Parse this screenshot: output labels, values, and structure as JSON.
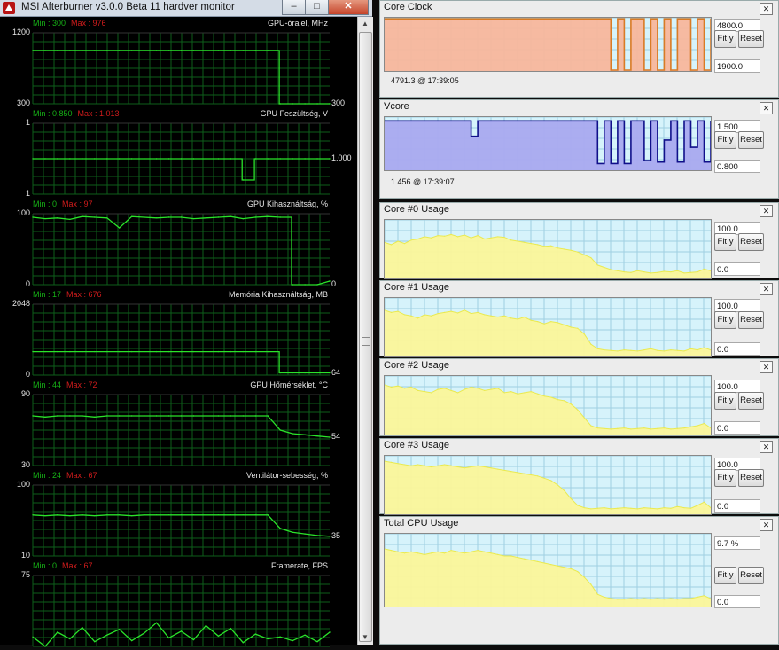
{
  "afterburner": {
    "title": "MSI Afterburner v3.0.0 Beta 11 hardver monitor",
    "graphs": [
      {
        "id": "gpu-clock",
        "name": "GPU-órajel, MHz",
        "min": "Min : 300",
        "max": "Max : 976",
        "top": "1200",
        "bottom": "300",
        "right": "300",
        "right_value": 300,
        "range": [
          300,
          1200
        ],
        "right2": ""
      },
      {
        "id": "gpu-voltage",
        "name": "GPU Feszültség, V",
        "min": "Min : 0.850",
        "max": "Max : 1.013",
        "top": "1",
        "bottom": "1",
        "right": "1.000",
        "right_value": 1.0,
        "range": [
          0.75,
          1.25
        ],
        "right2": ""
      },
      {
        "id": "gpu-usage",
        "name": "GPU Kihasználtság, %",
        "min": "Min : 0",
        "max": "Max : 97",
        "top": "100",
        "bottom": "0",
        "right": "0",
        "right_value": 0,
        "range": [
          0,
          100
        ],
        "right2": ""
      },
      {
        "id": "mem-usage",
        "name": "Memória Kihasználtság, MB",
        "min": "Min : 17",
        "max": "Max : 676",
        "top": "2048",
        "bottom": "0",
        "right": "64",
        "right_value": 64,
        "range": [
          0,
          2048
        ],
        "right2": ""
      },
      {
        "id": "gpu-temp",
        "name": "GPU Hőmérséklet, °C",
        "min": "Min : 44",
        "max": "Max : 72",
        "top": "90",
        "bottom": "30",
        "right": "54",
        "right_value": 54,
        "range": [
          30,
          90
        ],
        "right2": ""
      },
      {
        "id": "fan-speed",
        "name": "Ventilátor-sebesség, %",
        "min": "Min : 24",
        "max": "Max : 67",
        "top": "100",
        "bottom": "10",
        "right": "35",
        "right_value": 35,
        "range": [
          10,
          100
        ],
        "right2": ""
      },
      {
        "id": "framerate",
        "name": "Framerate, FPS",
        "min": "Min : 0",
        "max": "Max : 67",
        "top": "75",
        "bottom": "",
        "right": "",
        "right_value": null,
        "range": [
          0,
          75
        ],
        "right2": ""
      }
    ],
    "colors": {
      "line": "#2ae32a",
      "grid": "#0e5e1a",
      "bg": "#000000",
      "min": "#16b016",
      "max": "#d11c1c"
    }
  },
  "panels": [
    {
      "id": "core-clock",
      "title": "Core Clock",
      "top_value": "4800.0",
      "bottom_value": "1900.0",
      "info": "4791.3  @ 17:39:05",
      "fill": "#f8b69c",
      "line": "#d97b25",
      "min": 1900,
      "max": 4800,
      "kind": "clock",
      "fit": "Fit y",
      "reset": "Reset"
    },
    {
      "id": "vcore",
      "title": "Vcore",
      "top_value": "1.500",
      "bottom_value": "0.800",
      "info": "1.456  @ 17:39:07",
      "fill": "#a9a9ef",
      "line": "#10108a",
      "min": 0.8,
      "max": 1.5,
      "kind": "vcore",
      "fit": "Fit y",
      "reset": "Reset"
    },
    {
      "id": "core0",
      "title": "Core #0 Usage",
      "top_value": "100.0",
      "bottom_value": "0.0",
      "info": "",
      "fill": "#fbf69a",
      "line": "#eaea50",
      "min": 0,
      "max": 100,
      "kind": "usage",
      "fit": "Fit y",
      "reset": "Reset"
    },
    {
      "id": "core1",
      "title": "Core #1 Usage",
      "top_value": "100.0",
      "bottom_value": "0.0",
      "info": "",
      "fill": "#fbf69a",
      "line": "#eaea50",
      "min": 0,
      "max": 100,
      "kind": "usage",
      "fit": "Fit y",
      "reset": "Reset"
    },
    {
      "id": "core2",
      "title": "Core #2 Usage",
      "top_value": "100.0",
      "bottom_value": "0.0",
      "info": "",
      "fill": "#fbf69a",
      "line": "#eaea50",
      "min": 0,
      "max": 100,
      "kind": "usage",
      "fit": "Fit y",
      "reset": "Reset"
    },
    {
      "id": "core3",
      "title": "Core #3 Usage",
      "top_value": "100.0",
      "bottom_value": "0.0",
      "info": "",
      "fill": "#fbf69a",
      "line": "#eaea50",
      "min": 0,
      "max": 100,
      "kind": "usage",
      "fit": "Fit y",
      "reset": "Reset"
    },
    {
      "id": "total",
      "title": "Total CPU Usage",
      "top_value": "9.7 %",
      "bottom_value": "0.0",
      "info": "",
      "fill": "#fbf69a",
      "line": "#eaea50",
      "min": 0,
      "max": 100,
      "kind": "total",
      "fit": "Fit y",
      "reset": "Reset"
    }
  ],
  "chart_data": [
    {
      "type": "line",
      "title": "GPU-órajel, MHz",
      "ylim": [
        300,
        1200
      ],
      "series": [
        {
          "values": [
            976,
            976,
            976,
            976,
            976,
            976,
            976,
            976,
            976,
            976,
            976,
            976,
            976,
            976,
            976,
            976,
            976,
            976,
            976,
            976,
            300,
            300,
            300,
            300,
            300
          ]
        }
      ]
    },
    {
      "type": "line",
      "title": "GPU Feszültség, V",
      "ylim": [
        0.75,
        1.25
      ],
      "series": [
        {
          "values": [
            1.0,
            1.0,
            1.0,
            1.0,
            1.0,
            1.0,
            1.0,
            1.0,
            1.0,
            1.0,
            1.0,
            1.0,
            1.0,
            1.0,
            1.0,
            1.0,
            1.0,
            0.85,
            1.0,
            1.0,
            1.0,
            1.0,
            1.0,
            1.0,
            1.0
          ]
        }
      ]
    },
    {
      "type": "line",
      "title": "GPU Kihasználtság, %",
      "ylim": [
        0,
        100
      ],
      "series": [
        {
          "values": [
            95,
            93,
            94,
            92,
            96,
            95,
            94,
            80,
            96,
            95,
            94,
            95,
            95,
            93,
            94,
            95,
            96,
            93,
            95,
            96,
            95,
            0,
            0,
            0,
            5
          ]
        }
      ]
    },
    {
      "type": "line",
      "title": "Memória Kihasználtság, MB",
      "ylim": [
        0,
        2048
      ],
      "series": [
        {
          "values": [
            676,
            676,
            676,
            676,
            676,
            676,
            676,
            676,
            676,
            676,
            676,
            676,
            676,
            676,
            676,
            676,
            676,
            676,
            676,
            676,
            64,
            64,
            64,
            64,
            64
          ]
        }
      ]
    },
    {
      "type": "line",
      "title": "GPU Hőmérséklet, °C",
      "ylim": [
        30,
        90
      ],
      "series": [
        {
          "values": [
            72,
            71,
            72,
            72,
            72,
            71,
            72,
            72,
            72,
            72,
            72,
            72,
            72,
            72,
            72,
            72,
            72,
            72,
            72,
            72,
            60,
            57,
            56,
            55,
            54
          ]
        }
      ]
    },
    {
      "type": "line",
      "title": "Ventilátor-sebesség, %",
      "ylim": [
        10,
        100
      ],
      "series": [
        {
          "values": [
            62,
            61,
            62,
            61,
            62,
            61,
            62,
            62,
            61,
            62,
            62,
            62,
            62,
            62,
            62,
            62,
            62,
            62,
            62,
            62,
            45,
            40,
            38,
            36,
            35
          ]
        }
      ]
    },
    {
      "type": "line",
      "title": "Framerate, FPS",
      "ylim": [
        0,
        75
      ],
      "series": [
        {
          "values": [
            10,
            0,
            15,
            8,
            20,
            5,
            12,
            18,
            6,
            14,
            25,
            9,
            16,
            7,
            22,
            11,
            19,
            4,
            13,
            8,
            10,
            6,
            12,
            5,
            15
          ]
        }
      ]
    },
    {
      "type": "area",
      "title": "Core Clock",
      "ylim": [
        1900,
        4800
      ],
      "series": [
        {
          "values": [
            4791,
            4791,
            4791,
            4791,
            4791,
            4791,
            4791,
            4791,
            4791,
            4791,
            4791,
            4791,
            4791,
            4791,
            4791,
            4791,
            4791,
            4791,
            4791,
            4791,
            4791,
            4791,
            4791,
            4791,
            4791,
            4791,
            4791,
            4791,
            4791,
            4791,
            4791,
            4791,
            4791,
            4791,
            1900,
            4791,
            1900,
            4791,
            4791,
            1900,
            4791,
            1900,
            4791,
            1900,
            4791,
            4791,
            1900,
            4791,
            1900,
            4791
          ]
        }
      ]
    },
    {
      "type": "area",
      "title": "Vcore",
      "ylim": [
        0.8,
        1.5
      ],
      "series": [
        {
          "values": [
            1.46,
            1.46,
            1.46,
            1.46,
            1.46,
            1.46,
            1.46,
            1.46,
            1.46,
            1.46,
            1.46,
            1.46,
            1.46,
            1.25,
            1.46,
            1.46,
            1.46,
            1.46,
            1.46,
            1.46,
            1.46,
            1.46,
            1.46,
            1.46,
            1.46,
            1.46,
            1.46,
            1.46,
            1.46,
            1.46,
            1.46,
            1.46,
            0.88,
            1.46,
            0.88,
            1.46,
            0.88,
            1.46,
            1.46,
            0.92,
            1.46,
            0.9,
            1.2,
            1.46,
            0.9,
            1.46,
            1.1,
            1.46,
            0.9,
            1.456
          ]
        }
      ]
    },
    {
      "type": "area",
      "title": "Core #0 Usage",
      "ylim": [
        0,
        100
      ],
      "series": [
        {
          "values": [
            62,
            58,
            64,
            60,
            66,
            68,
            72,
            70,
            74,
            73,
            76,
            72,
            75,
            70,
            74,
            68,
            70,
            72,
            71,
            66,
            64,
            62,
            60,
            58,
            55,
            56,
            52,
            50,
            48,
            45,
            40,
            35,
            22,
            18,
            14,
            12,
            10,
            9,
            12,
            10,
            8,
            9,
            11,
            10,
            12,
            8,
            9,
            10,
            15,
            12
          ]
        }
      ]
    },
    {
      "type": "area",
      "title": "Core #1 Usage",
      "ylim": [
        0,
        100
      ],
      "series": [
        {
          "values": [
            80,
            76,
            78,
            72,
            70,
            66,
            72,
            70,
            74,
            76,
            78,
            75,
            80,
            74,
            76,
            72,
            70,
            68,
            70,
            66,
            64,
            68,
            62,
            60,
            56,
            60,
            58,
            54,
            50,
            48,
            38,
            20,
            12,
            10,
            9,
            8,
            10,
            9,
            8,
            10,
            12,
            9,
            8,
            10,
            9,
            8,
            12,
            10,
            14,
            10
          ]
        }
      ]
    },
    {
      "type": "area",
      "title": "Core #2 Usage",
      "ylim": [
        0,
        100
      ],
      "series": [
        {
          "values": [
            86,
            82,
            84,
            80,
            82,
            76,
            74,
            72,
            78,
            80,
            76,
            72,
            78,
            82,
            80,
            76,
            78,
            80,
            72,
            74,
            70,
            72,
            74,
            70,
            66,
            64,
            60,
            58,
            52,
            42,
            28,
            14,
            10,
            9,
            8,
            9,
            10,
            8,
            9,
            10,
            8,
            9,
            10,
            8,
            9,
            10,
            12,
            14,
            18,
            10
          ]
        }
      ]
    },
    {
      "type": "area",
      "title": "Core #3 Usage",
      "ylim": [
        0,
        100
      ],
      "series": [
        {
          "values": [
            92,
            90,
            88,
            86,
            84,
            86,
            84,
            82,
            84,
            86,
            84,
            82,
            80,
            82,
            84,
            82,
            80,
            78,
            76,
            74,
            72,
            70,
            68,
            66,
            62,
            58,
            50,
            40,
            26,
            14,
            10,
            8,
            9,
            10,
            8,
            9,
            10,
            9,
            8,
            10,
            9,
            8,
            10,
            9,
            12,
            10,
            9,
            14,
            20,
            10
          ]
        }
      ]
    },
    {
      "type": "area",
      "title": "Total CPU Usage",
      "ylim": [
        0,
        100
      ],
      "series": [
        {
          "values": [
            80,
            78,
            76,
            74,
            76,
            74,
            72,
            74,
            76,
            74,
            78,
            76,
            74,
            76,
            78,
            76,
            74,
            72,
            70,
            70,
            68,
            66,
            64,
            62,
            60,
            58,
            56,
            54,
            52,
            48,
            40,
            30,
            16,
            12,
            10,
            9,
            9,
            10,
            9,
            10,
            9,
            10,
            9,
            10,
            9,
            10,
            10,
            12,
            14,
            9.7
          ]
        }
      ]
    }
  ]
}
